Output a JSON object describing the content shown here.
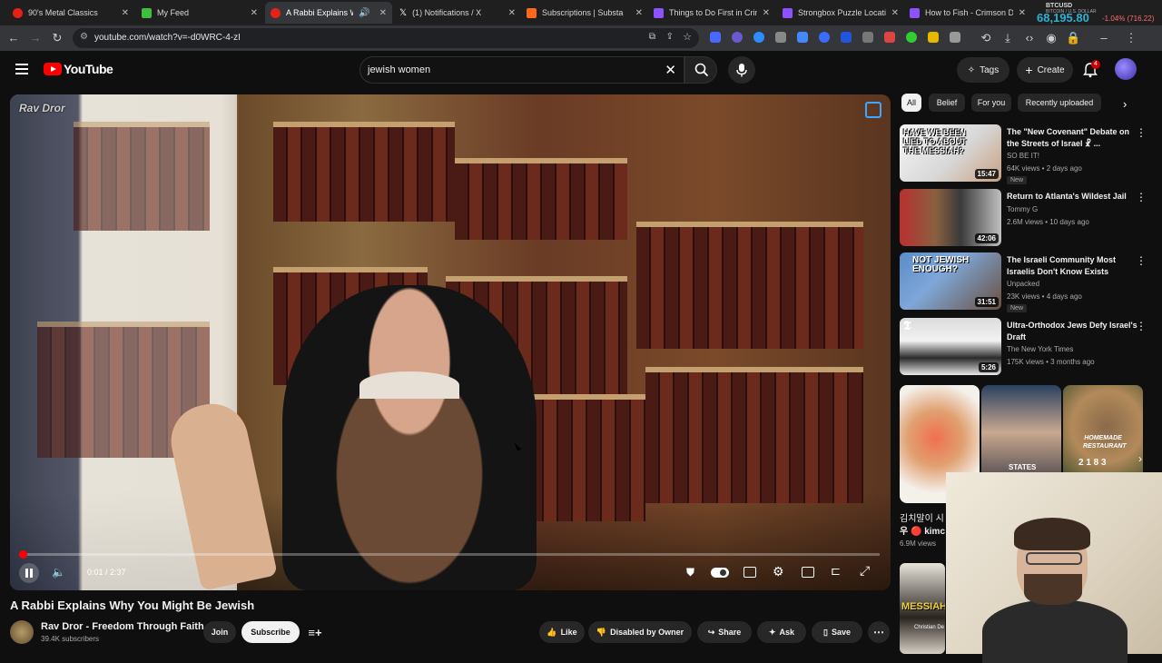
{
  "browser": {
    "tabs": [
      {
        "title": "90's Metal Classics",
        "color": "#e62117"
      },
      {
        "title": "My Feed",
        "color": "#3fbf3f"
      },
      {
        "title": "A Rabbi Explains Why",
        "color": "#e62117"
      },
      {
        "title": "(1) Notifications / X",
        "color": "#ffffff"
      },
      {
        "title": "Subscriptions | Substa",
        "color": "#ff6719"
      },
      {
        "title": "Things to Do First in Crim",
        "color": "#8c52ff"
      },
      {
        "title": "Strongbox Puzzle Locatio",
        "color": "#8c52ff"
      },
      {
        "title": "How to Fish - Crimson De",
        "color": "#8c52ff"
      }
    ],
    "ticker": {
      "symbol": "BTCUSD",
      "subtitle": "BITCOIN / U.S. DOLLAR",
      "price": "68,195.80",
      "change": "-1.04% (716.22)"
    },
    "url": "youtube.com/watch?v=-d0WRC-4-zI"
  },
  "youtube": {
    "logo_text": "YouTube",
    "search_query": "jewish women",
    "tags_label": "Tags",
    "create_label": "Create",
    "notif_count": "4"
  },
  "player": {
    "watermark": "Rav Dror",
    "time": "0:01 / 2:37",
    "progress_fraction": 0.006
  },
  "video": {
    "title": "A Rabbi Explains Why You Might Be Jewish",
    "channel": "Rav Dror - Freedom Through Faith",
    "subscribers": "39.4K subscribers",
    "join_label": "Join",
    "subscribe_label": "Subscribe",
    "like_label": "Like",
    "dislike_label": "Disabled by Owner",
    "share_label": "Share",
    "ask_label": "Ask",
    "save_label": "Save"
  },
  "chips": [
    "All",
    "Belief",
    "For you",
    "Recently uploaded"
  ],
  "recommendations": [
    {
      "title": "The \"New Covenant\" Debate on the Streets of Israel ☧ ...",
      "channel": "SO BE IT!",
      "meta": "64K views • 2 days ago",
      "badge": "New",
      "duration": "15:47",
      "thumb_text": "HAVE WE BEEN LIED TO ABOUT THE MESSIAH?"
    },
    {
      "title": "Return to Atlanta's Wildest Jail",
      "channel": "Tommy G",
      "meta": "2.6M views • 10 days ago",
      "badge": "",
      "duration": "42:06",
      "thumb_text": ""
    },
    {
      "title": "The Israeli Community Most Israelis Don't Know Exists",
      "channel": "Unpacked",
      "meta": "23K views • 4 days ago",
      "badge": "New",
      "duration": "31:51",
      "thumb_text": "NOT JEWISH ENOUGH?"
    },
    {
      "title": "Ultra-Orthodox Jews Defy Israel's Draft",
      "channel": "The New York Times",
      "meta": "175K views • 3 months ago",
      "badge": "",
      "duration": "5:26",
      "thumb_text": ""
    }
  ],
  "shorts": {
    "labels": [
      "STATES",
      "HOMEMADE RESTAURANT"
    ],
    "partial_title_1": "김치말이 시",
    "partial_title_2": "우 🔴 kimc",
    "partial_views": "6.9M views",
    "counts": "2 1  8  3",
    "messiah_text": "MESSIAH",
    "partial_channel": "Christian De"
  }
}
